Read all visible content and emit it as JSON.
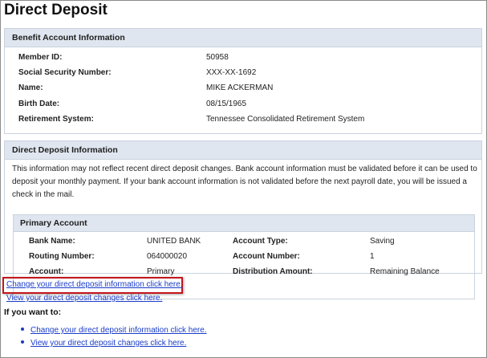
{
  "page": {
    "title": "Direct Deposit"
  },
  "benefit": {
    "header": "Benefit Account Information",
    "fields": [
      {
        "label": "Member ID:",
        "value": "50958"
      },
      {
        "label": "Social Security Number:",
        "value": "XXX-XX-1692"
      },
      {
        "label": "Name:",
        "value": "MIKE ACKERMAN"
      },
      {
        "label": "Birth Date:",
        "value": "08/15/1965"
      },
      {
        "label": "Retirement System:",
        "value": "Tennessee Consolidated Retirement System"
      }
    ]
  },
  "deposit": {
    "header": "Direct Deposit Information",
    "notice": "This information may not reflect recent direct deposit changes. Bank account information must be validated before it can be used to deposit your monthly payment. If your bank account information is not validated before the next payroll date, you will be issued a check in the mail.",
    "primary": {
      "header": "Primary Account",
      "left": [
        {
          "label": "Bank Name:",
          "value": "UNITED BANK"
        },
        {
          "label": "Routing Number:",
          "value": "064000020"
        },
        {
          "label": "Account:",
          "value": "Primary"
        }
      ],
      "right": [
        {
          "label": "Account Type:",
          "value": "Saving"
        },
        {
          "label": "Account Number:",
          "value": "1"
        },
        {
          "label": "Distribution Amount:",
          "value": "Remaining Balance"
        }
      ]
    }
  },
  "links": {
    "change": "Change your direct deposit information click here.",
    "view": "View your direct deposit changes click here."
  },
  "want": {
    "heading": "If you want to:",
    "items": [
      "Change your direct deposit information click here.",
      "View your direct deposit changes click here."
    ]
  },
  "colors": {
    "link": "#1a3cc8",
    "highlight": "#c4161c",
    "panel_header": "#dfe6ef"
  }
}
